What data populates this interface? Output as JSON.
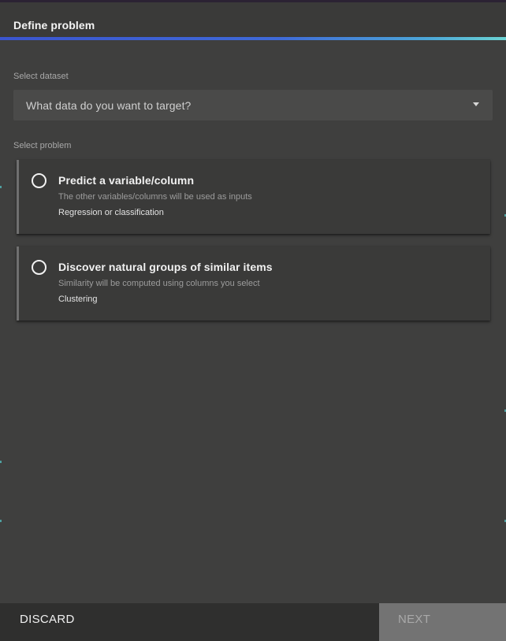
{
  "header": {
    "title": "Define problem"
  },
  "dataset": {
    "label": "Select dataset",
    "placeholder": "What data do you want to target?",
    "icon": "chevron-down-icon"
  },
  "problem": {
    "label": "Select problem",
    "options": [
      {
        "title": "Predict a variable/column",
        "description": "The other variables/columns will be used as inputs",
        "tag": "Regression or classification"
      },
      {
        "title": "Discover natural groups of similar items",
        "description": "Similarity will be computed using columns you select",
        "tag": "Clustering"
      }
    ]
  },
  "footer": {
    "discard_label": "DISCARD",
    "next_label": "NEXT"
  },
  "colors": {
    "accent_start": "#3b55cf",
    "accent_end": "#6bd3d3",
    "background": "#3f3f3e",
    "card": "#3a3a39"
  }
}
